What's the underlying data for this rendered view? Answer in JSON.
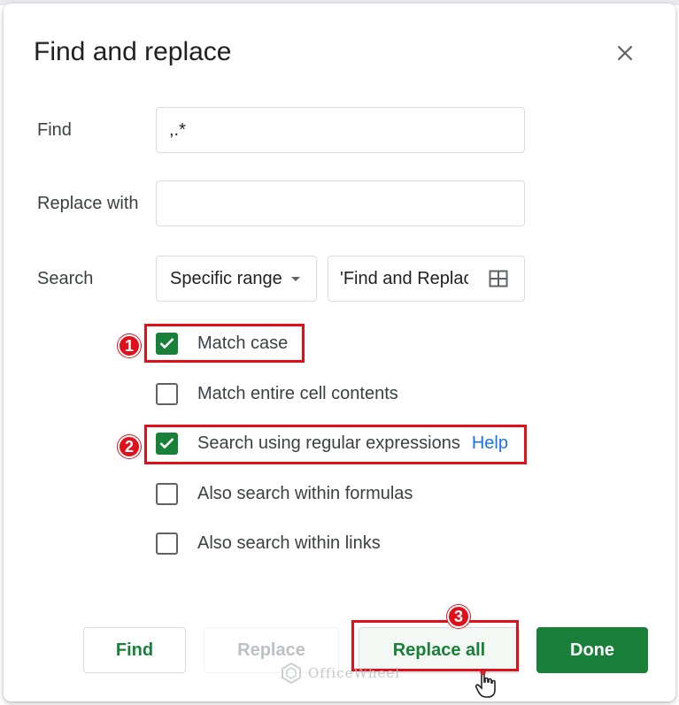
{
  "dialog": {
    "title": "Find and replace"
  },
  "form": {
    "find_label": "Find",
    "find_value": ",.*",
    "replace_label": "Replace with",
    "replace_value": "",
    "search_label": "Search",
    "search_scope": "Specific range",
    "range_value": "'Find and Replace"
  },
  "options": [
    {
      "label": "Match case",
      "checked": true
    },
    {
      "label": "Match entire cell contents",
      "checked": false
    },
    {
      "label": "Search using regular expressions",
      "checked": true
    },
    {
      "label": "Also search within formulas",
      "checked": false
    },
    {
      "label": "Also search within links",
      "checked": false
    }
  ],
  "help_link": "Help",
  "buttons": {
    "find": "Find",
    "replace": "Replace",
    "replace_all": "Replace all",
    "done": "Done"
  },
  "annotations": {
    "step1": "1",
    "step2": "2",
    "step3": "3",
    "highlight_color": "#e0101b"
  },
  "watermark": {
    "text": "OfficeWheel"
  },
  "colors": {
    "accent": "#188038",
    "link": "#1a73e8"
  },
  "icons": {
    "close": "close-icon",
    "dropdown": "caret-down-icon",
    "range_picker": "grid-icon",
    "check": "checkmark-icon",
    "cursor": "hand-pointer-icon"
  }
}
